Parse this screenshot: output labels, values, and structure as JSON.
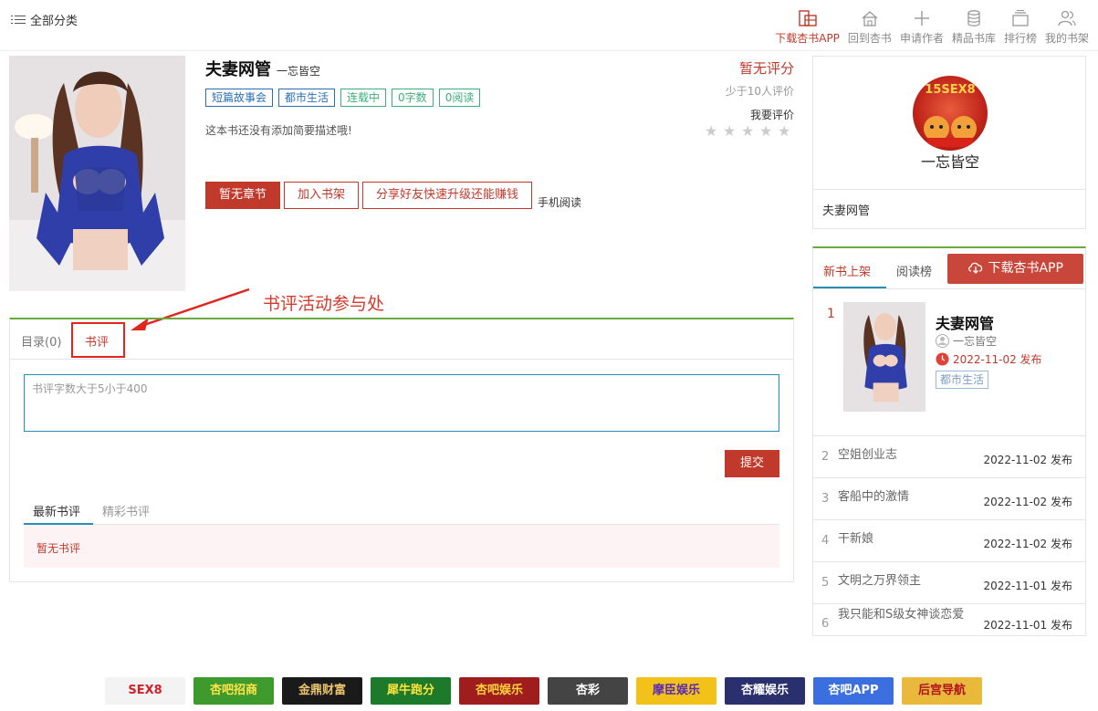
{
  "header": {
    "category_label": "全部分类",
    "nav": [
      {
        "label": "下载杏书APP",
        "icon": "phone-download-icon",
        "active": true
      },
      {
        "label": "回到杏书",
        "icon": "home-icon",
        "active": false
      },
      {
        "label": "申请作者",
        "icon": "plus-icon",
        "active": false
      },
      {
        "label": "精品书库",
        "icon": "database-icon",
        "active": false
      },
      {
        "label": "排行榜",
        "icon": "ranking-icon",
        "active": false
      },
      {
        "label": "我的书架",
        "icon": "users-icon",
        "active": false
      }
    ]
  },
  "book": {
    "title": "夫妻网管",
    "author": "一忘皆空",
    "tags": [
      {
        "label": "短篇故事会",
        "style": "blue"
      },
      {
        "label": "都市生活",
        "style": "blue"
      },
      {
        "label": "连载中",
        "style": "green"
      },
      {
        "label": "0字数",
        "style": "green"
      },
      {
        "label": "0阅读",
        "style": "green"
      }
    ],
    "description": "这本书还没有添加简要描述哦!",
    "buttons": {
      "read": "暂无章节",
      "shelf": "加入书架",
      "share": "分享好友快速升级还能赚钱",
      "mobile": "手机阅读"
    },
    "score": "暂无评分",
    "score_sub": "少于10人评价",
    "rate_label": "我要评价",
    "stars": 5
  },
  "annotation": "书评活动参与处",
  "panel": {
    "tabs": {
      "catalog": "目录(0)",
      "review": "书评"
    },
    "placeholder": "书评字数大于5小于400",
    "submit": "提交",
    "comment_tabs": {
      "latest": "最新书评",
      "featured": "精彩书评"
    },
    "empty": "暂无书评"
  },
  "author_card": {
    "avatar_text": "15SEX8",
    "name": "一忘皆空",
    "book": "夫妻网管"
  },
  "list": {
    "tabs": {
      "new": "新书上架",
      "rank": "阅读榜"
    },
    "download": "下载杏书APP",
    "featured": {
      "rank": "1",
      "title": "夫妻网管",
      "author": "一忘皆空",
      "date": "2022-11-02 发布",
      "tag": "都市生活"
    },
    "rows": [
      {
        "n": "2",
        "title": "空姐创业志",
        "date": "2022-11-02 发布"
      },
      {
        "n": "3",
        "title": "客船中的激情",
        "date": "2022-11-02 发布"
      },
      {
        "n": "4",
        "title": "干新娘",
        "date": "2022-11-02 发布"
      },
      {
        "n": "5",
        "title": "文明之万界领主",
        "date": "2022-11-01 发布"
      },
      {
        "n": "6",
        "title": "我只能和S级女神谈恋爱",
        "date": "2022-11-01 发布"
      }
    ]
  },
  "ads": [
    {
      "label": "SEX8",
      "color": "#f3f3f3",
      "text": "#d4202a"
    },
    {
      "label": "杏吧招商",
      "color": "#3e9a2c",
      "text": "#ffe44a"
    },
    {
      "label": "金鼎财富",
      "color": "#1a1a1a",
      "text": "#e8c36b"
    },
    {
      "label": "犀牛跑分",
      "color": "#1c7a2a",
      "text": "#ffe23a"
    },
    {
      "label": "杏吧娱乐",
      "color": "#a01d1d",
      "text": "#ffd43a"
    },
    {
      "label": "杏彩",
      "color": "#444444",
      "text": "#ffffff"
    },
    {
      "label": "摩臣娱乐",
      "color": "#f2c21b",
      "text": "#5a2ab5"
    },
    {
      "label": "杏耀娱乐",
      "color": "#2a2f6e",
      "text": "#ffffff"
    },
    {
      "label": "杏吧APP",
      "color": "#3b6fe0",
      "text": "#ffffff"
    },
    {
      "label": "后宫导航",
      "color": "#e9b93c",
      "text": "#b0131e"
    }
  ]
}
